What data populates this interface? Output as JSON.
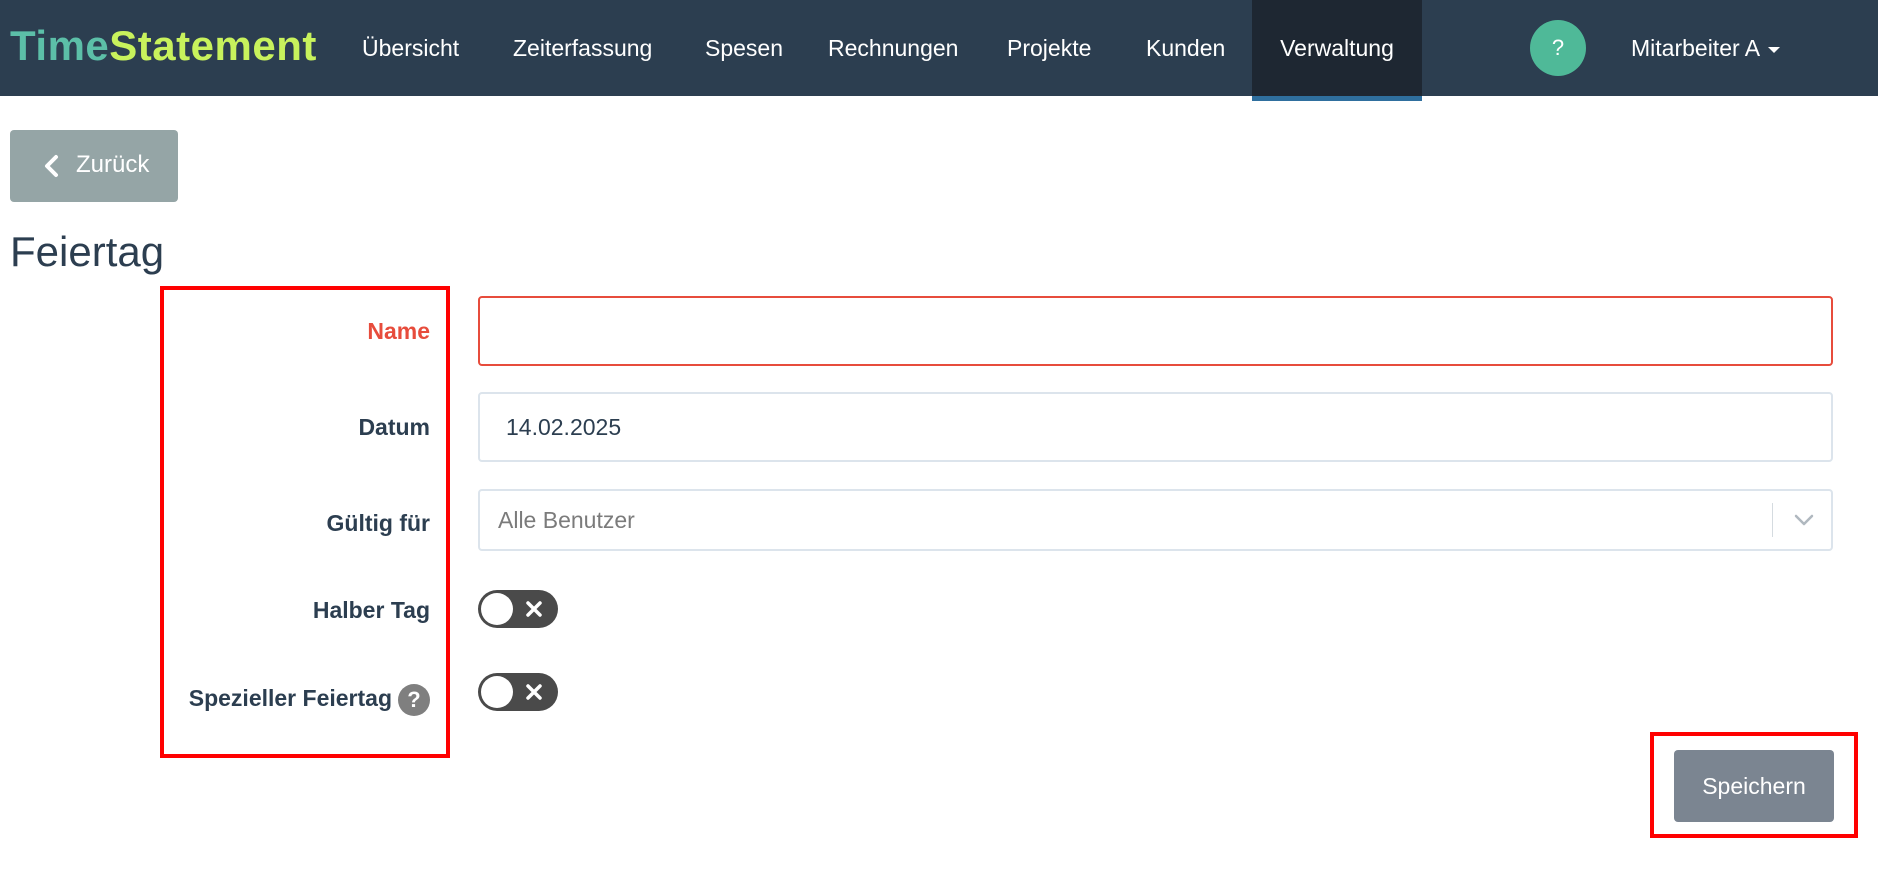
{
  "navbar": {
    "brand_part1": "Time",
    "brand_part2": "Statement",
    "items": [
      {
        "label": "Übersicht"
      },
      {
        "label": "Zeiterfassung"
      },
      {
        "label": "Spesen"
      },
      {
        "label": "Rechnungen"
      },
      {
        "label": "Projekte"
      },
      {
        "label": "Kunden"
      },
      {
        "label": "Verwaltung",
        "active": true
      }
    ],
    "help_label": "?",
    "user_label": "Mitarbeiter A"
  },
  "back_button": {
    "label": "Zurück"
  },
  "page_title": "Feiertag",
  "form": {
    "name": {
      "label": "Name",
      "value": ""
    },
    "date": {
      "label": "Datum",
      "value": "14.02.2025"
    },
    "valid_for": {
      "label": "Gültig für",
      "value": "Alle Benutzer"
    },
    "half_day": {
      "label": "Halber Tag",
      "checked": false
    },
    "special_holiday": {
      "label": "Spezieller Feiertag",
      "help": "?",
      "checked": false
    }
  },
  "save_button": {
    "label": "Speichern"
  },
  "colors": {
    "navbar_bg": "#2c3e50",
    "brand_time": "#5cbfa8",
    "brand_statement": "#c8f25c",
    "error": "#e74c3c",
    "annotation": "#ff0000"
  }
}
